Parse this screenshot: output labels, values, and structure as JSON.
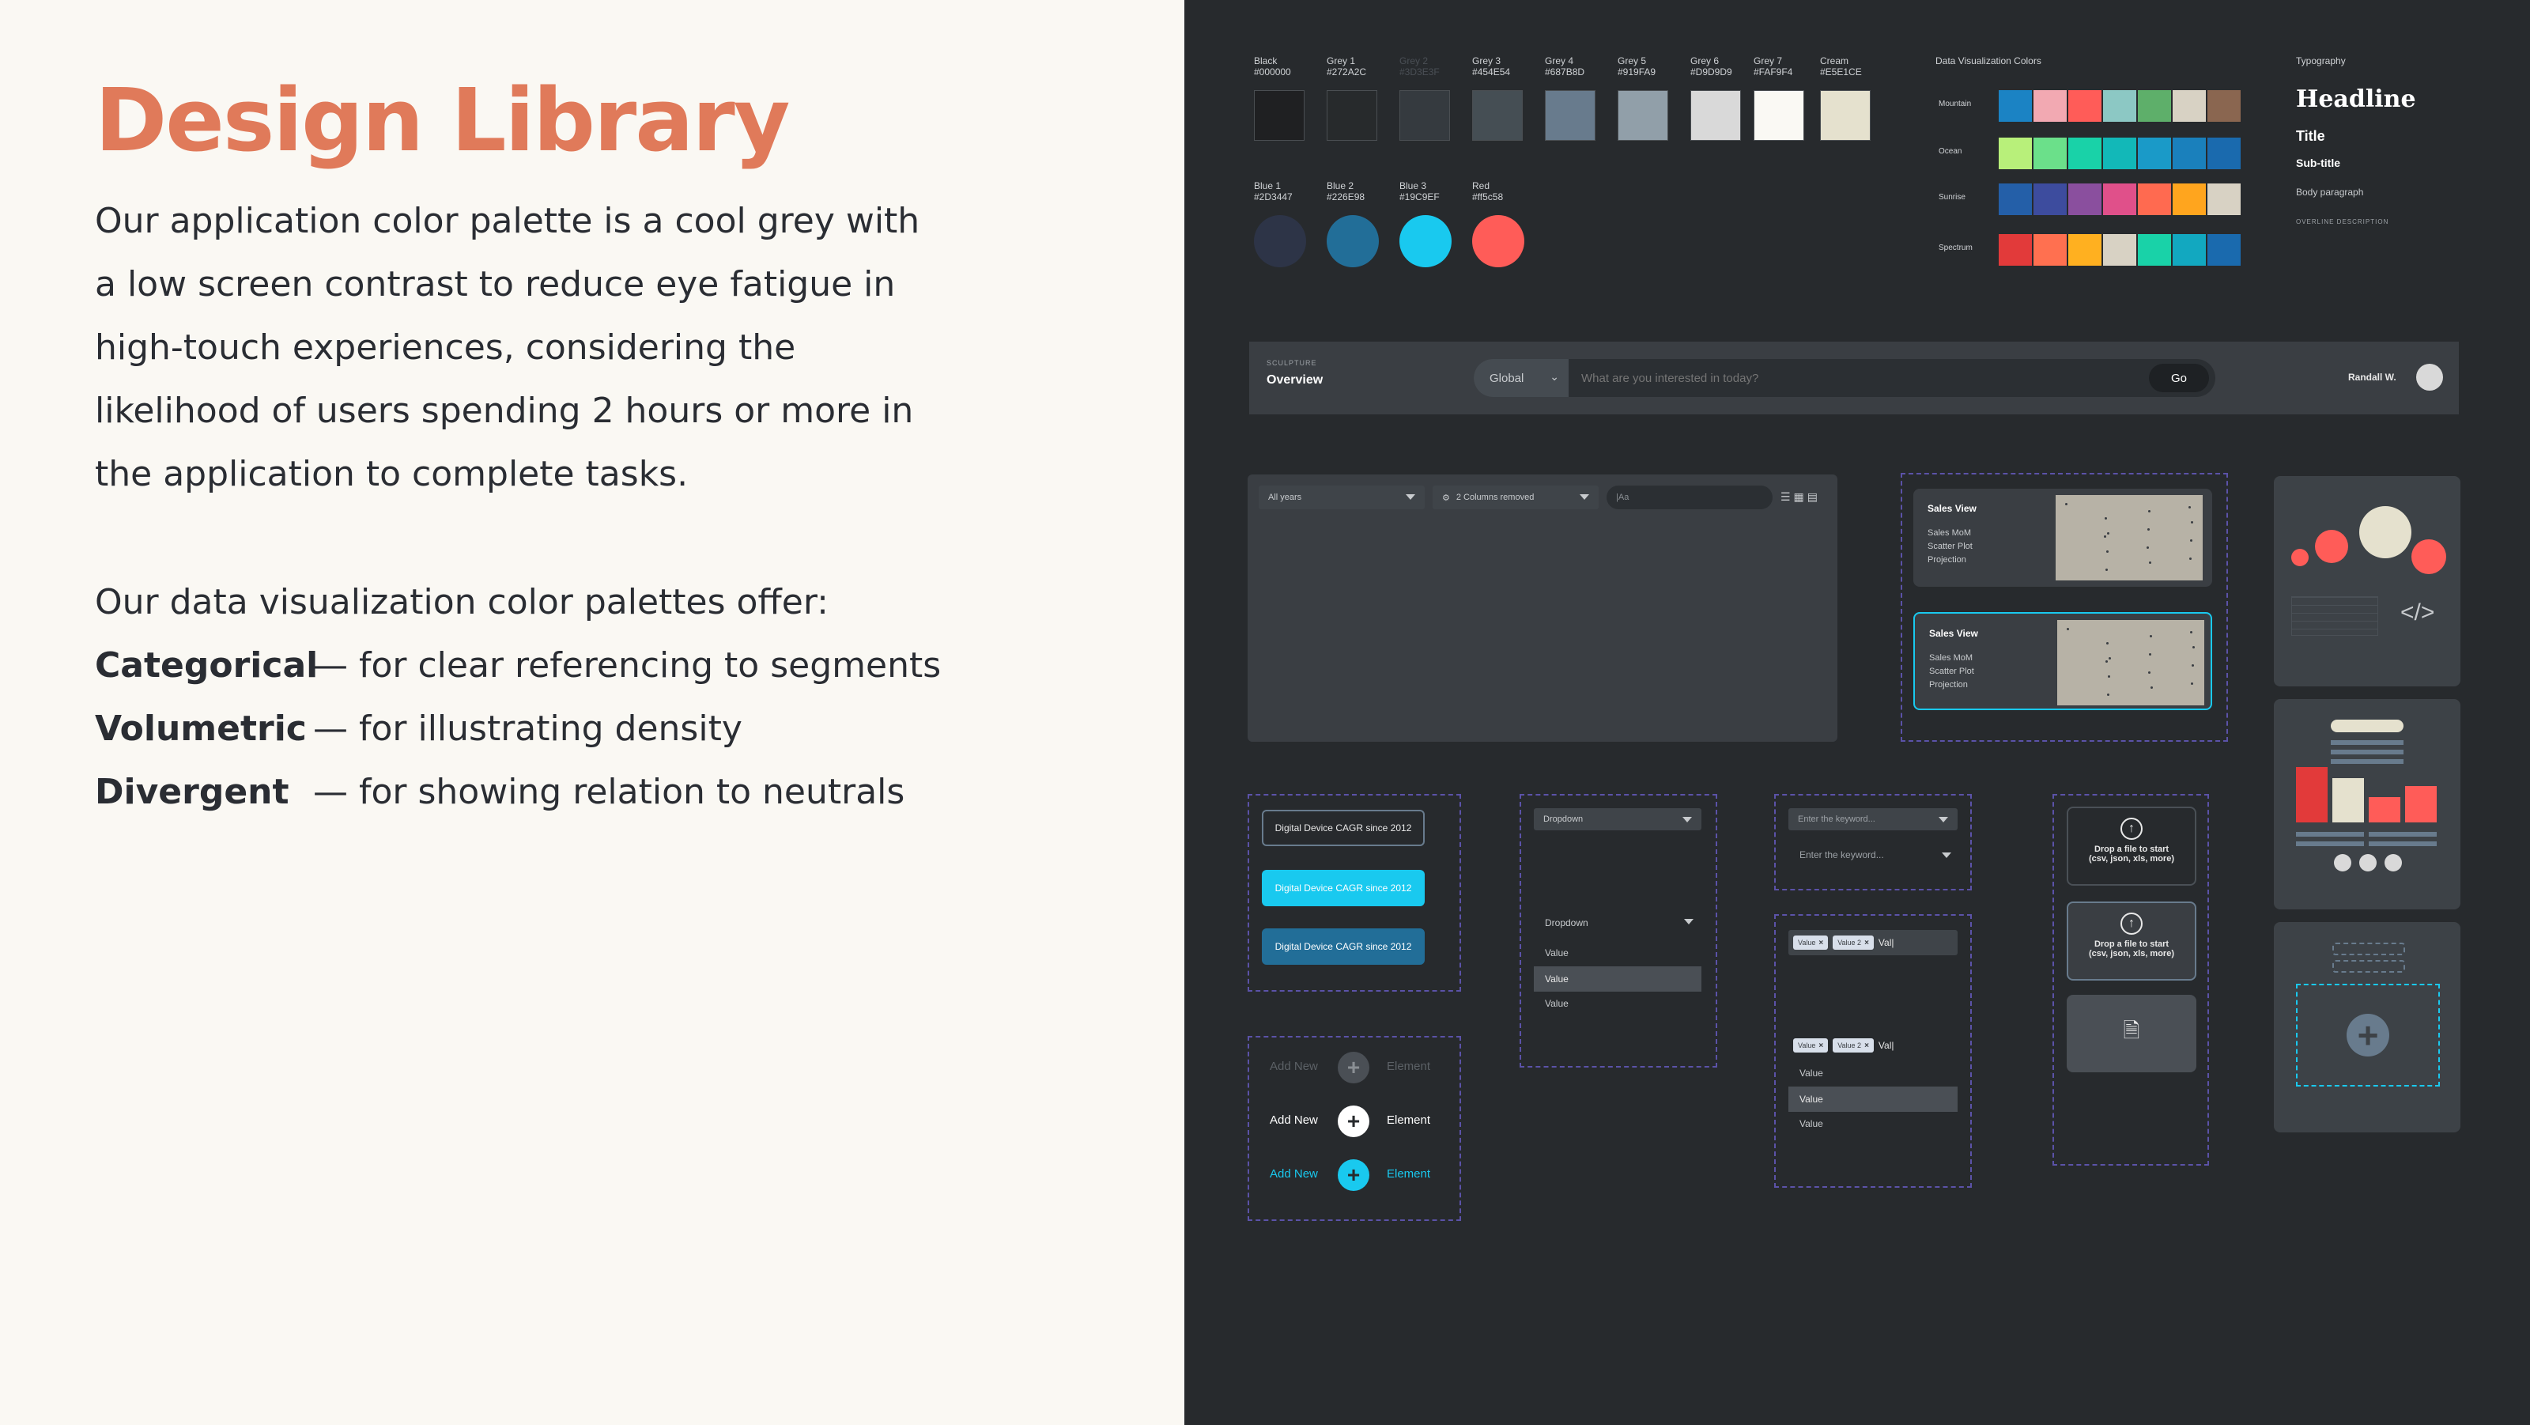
{
  "left": {
    "title": "Design Library",
    "paragraph1": [
      "Our application color palette is a cool grey with",
      "a low screen contrast to reduce eye fatigue in",
      "high-touch experiences, considering the",
      "likelihood of users spending 2 hours or more in",
      "the application to complete tasks."
    ],
    "palettes_intro": "Our data visualization color palettes offer:",
    "palettes": [
      {
        "term": "Categorical",
        "desc": "— for clear referencing to segments"
      },
      {
        "term": "Volumetric",
        "desc": "— for illustrating density"
      },
      {
        "term": "Divergent",
        "desc": "— for showing relation to neutrals"
      }
    ]
  },
  "colors": {
    "grey_row": [
      {
        "name": "Black",
        "hex": "#000000",
        "color": "#1F2022"
      },
      {
        "name": "Grey 1",
        "hex": "#272A2C",
        "color": "#272A2C"
      },
      {
        "name": "Grey 2",
        "hex": "#3D3E3F",
        "color": "#353A3F"
      },
      {
        "name": "Grey 3",
        "hex": "#454E54",
        "color": "#454E54"
      },
      {
        "name": "Grey 4",
        "hex": "#687B8D",
        "color": "#687B8D"
      },
      {
        "name": "Grey 5",
        "hex": "#919FA9",
        "color": "#919FA9"
      },
      {
        "name": "Grey 6",
        "hex": "#D9D9D9",
        "color": "#D9D9D9"
      },
      {
        "name": "Grey 7",
        "hex": "#FAF9F4",
        "color": "#FAF9F4"
      },
      {
        "name": "Cream",
        "hex": "#E5E1CE",
        "color": "#E5E1CE"
      }
    ],
    "accent_row": [
      {
        "name": "Blue 1",
        "hex": "#2D3447",
        "color": "#2D3447"
      },
      {
        "name": "Blue 2",
        "hex": "#226E98",
        "color": "#226E98"
      },
      {
        "name": "Blue 3",
        "hex": "#19C9EF",
        "color": "#19C9EF"
      },
      {
        "name": "Red",
        "hex": "#ff5c58",
        "color": "#FF5C58"
      }
    ]
  },
  "dataviz": {
    "heading": "Data Visualization Colors",
    "palettes": [
      {
        "name": "Mountain",
        "colors": [
          "#1B83C4",
          "#F2A9B2",
          "#FF5C58",
          "#8CC8C4",
          "#5EAF6A",
          "#D8D2C4",
          "#8A6650"
        ]
      },
      {
        "name": "Ocean",
        "colors": [
          "#B8F07A",
          "#6BE08A",
          "#19D2A8",
          "#12B8B8",
          "#1A9AC8",
          "#1A80BC",
          "#1A6AAE"
        ]
      },
      {
        "name": "Sunrise",
        "colors": [
          "#245FA8",
          "#3D4C9E",
          "#8A4F9E",
          "#E0508A",
          "#FF6A50",
          "#FFA51E",
          "#D8D2C4"
        ]
      },
      {
        "name": "Spectrum",
        "colors": [
          "#E23A3A",
          "#FF7050",
          "#FFB020",
          "#D8D2C4",
          "#19D2A8",
          "#12A8C0",
          "#1A6AAE"
        ]
      }
    ]
  },
  "typography": {
    "heading": "Typography",
    "headline": "Headline",
    "title": "Title",
    "subtitle": "Sub-title",
    "body": "Body paragraph",
    "overline": "OVERLINE DESCRIPTION"
  },
  "navbar": {
    "app_name": "SCULPTURE",
    "page": "Overview",
    "scope": "Global",
    "search_placeholder": "What are you interested in today?",
    "go_label": "Go",
    "user": "Randall W."
  },
  "filters": {
    "years": "All years",
    "columns": "2 Columns removed",
    "search": "|Aa"
  },
  "cards": [
    {
      "title": "Sales View",
      "lines": [
        "Sales MoM",
        "Scatter Plot",
        "Projection"
      ]
    },
    {
      "title": "Sales View",
      "lines": [
        "Sales MoM",
        "Scatter Plot",
        "Projection"
      ]
    }
  ],
  "buttons": {
    "label": "Digital Device CAGR since 2012"
  },
  "add_element": {
    "left": "Add New",
    "right": "Element"
  },
  "dropdowns": {
    "label": "Dropdown",
    "values": [
      "Value",
      "Value",
      "Value"
    ]
  },
  "keyword": {
    "placeholder": "Enter the keyword..."
  },
  "multiselect": {
    "chips": [
      "Value",
      "Value 2"
    ],
    "typed": "Val|",
    "values": [
      "Value",
      "Value",
      "Value"
    ]
  },
  "upload": {
    "line1": "Drop a file to start",
    "line2": "(csv, json, xls, more)"
  }
}
